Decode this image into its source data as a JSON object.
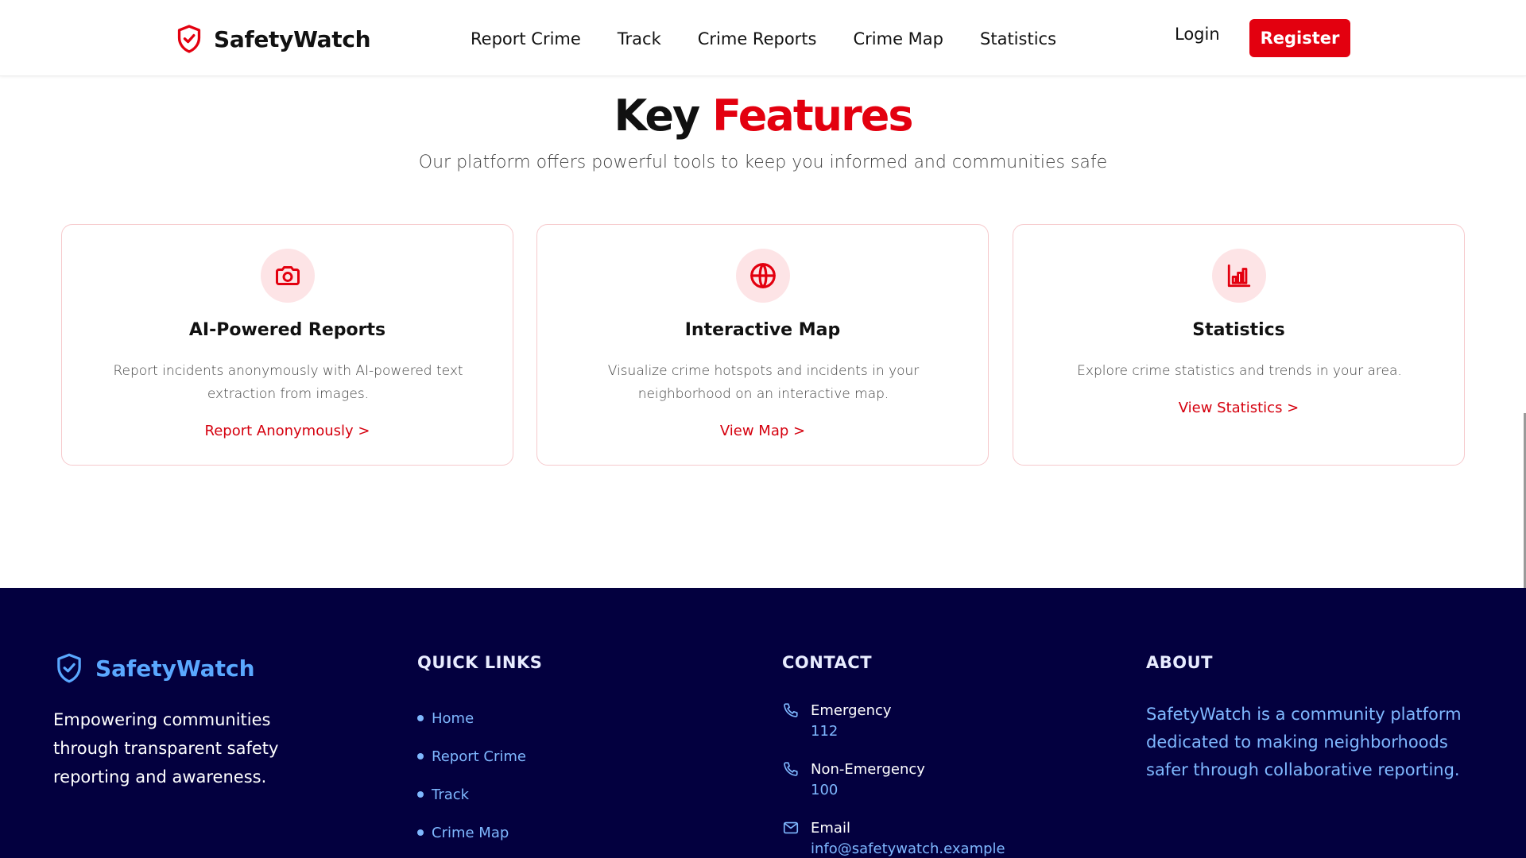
{
  "header": {
    "brand": "SafetyWatch",
    "nav": [
      "Report Crime",
      "Track",
      "Crime Reports",
      "Crime Map",
      "Statistics"
    ],
    "login": "Login",
    "register": "Register"
  },
  "features": {
    "title_plain": "Key",
    "title_accent": "Features",
    "subtitle": "Our platform offers powerful tools to keep you informed and communities safe",
    "cards": [
      {
        "icon": "camera-icon",
        "title": "AI-Powered Reports",
        "description": "Report incidents anonymously with AI-powered text extraction from images.",
        "link": "Report Anonymously >"
      },
      {
        "icon": "globe-icon",
        "title": "Interactive Map",
        "description": "Visualize crime hotspots and incidents in your neighborhood on an interactive map.",
        "link": "View Map >"
      },
      {
        "icon": "bar-chart-icon",
        "title": "Statistics",
        "description": "Explore crime statistics and trends in your area.",
        "link": "View Statistics >"
      }
    ]
  },
  "footer": {
    "brand": "SafetyWatch",
    "tagline": "Empowering communities through transparent safety reporting and awareness.",
    "quick_links_heading": "QUICK LINKS",
    "quick_links": [
      "Home",
      "Report Crime",
      "Track",
      "Crime Map"
    ],
    "contact_heading": "CONTACT",
    "contact": [
      {
        "icon": "phone-icon",
        "label": "Emergency",
        "value": "112"
      },
      {
        "icon": "phone-icon",
        "label": "Non-Emergency",
        "value": "100"
      },
      {
        "icon": "mail-icon",
        "label": "Email",
        "value": "info@safetywatch.example"
      }
    ],
    "about_heading": "ABOUT",
    "about": "SafetyWatch is a community platform dedicated to making neighborhoods safer through collaborative reporting."
  },
  "colors": {
    "accent": "#e3000f",
    "footer_bg": "#03003f",
    "footer_link": "#7fb8ff"
  }
}
